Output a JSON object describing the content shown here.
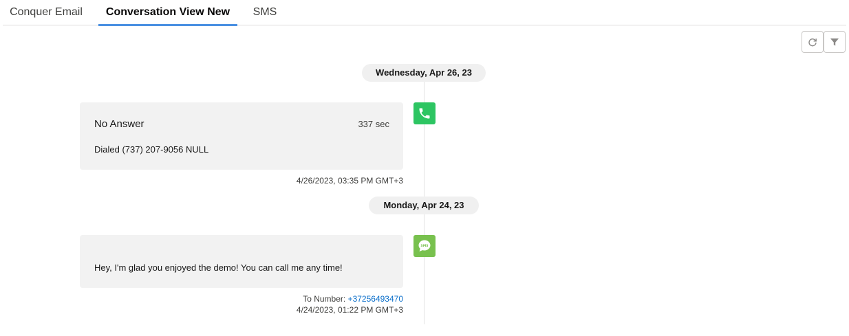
{
  "tabs": [
    {
      "label": "Conquer Email",
      "active": false
    },
    {
      "label": "Conversation View New",
      "active": true
    },
    {
      "label": "SMS",
      "active": false
    }
  ],
  "toolbar": {
    "refresh_icon": "refresh-icon",
    "filter_icon": "filter-icon"
  },
  "timeline": {
    "groups": [
      {
        "date": "Wednesday, Apr 26, 23",
        "event": {
          "type": "call",
          "icon": "phone-icon",
          "icon_color": "#2dc562",
          "title": "No Answer",
          "duration": "337 sec",
          "body": "Dialed (737) 207-9056 NULL",
          "timestamp": "4/26/2023, 03:35 PM GMT+3"
        }
      },
      {
        "date": "Monday, Apr 24, 23",
        "event": {
          "type": "sms",
          "icon": "sms-icon",
          "icon_color": "#78c14e",
          "body": "Hey, I'm glad you enjoyed the demo! You can call me any time!",
          "to_label": "To Number:",
          "to_number": "+37256493470",
          "timestamp": "4/24/2023, 01:22 PM GMT+3"
        }
      }
    ]
  }
}
